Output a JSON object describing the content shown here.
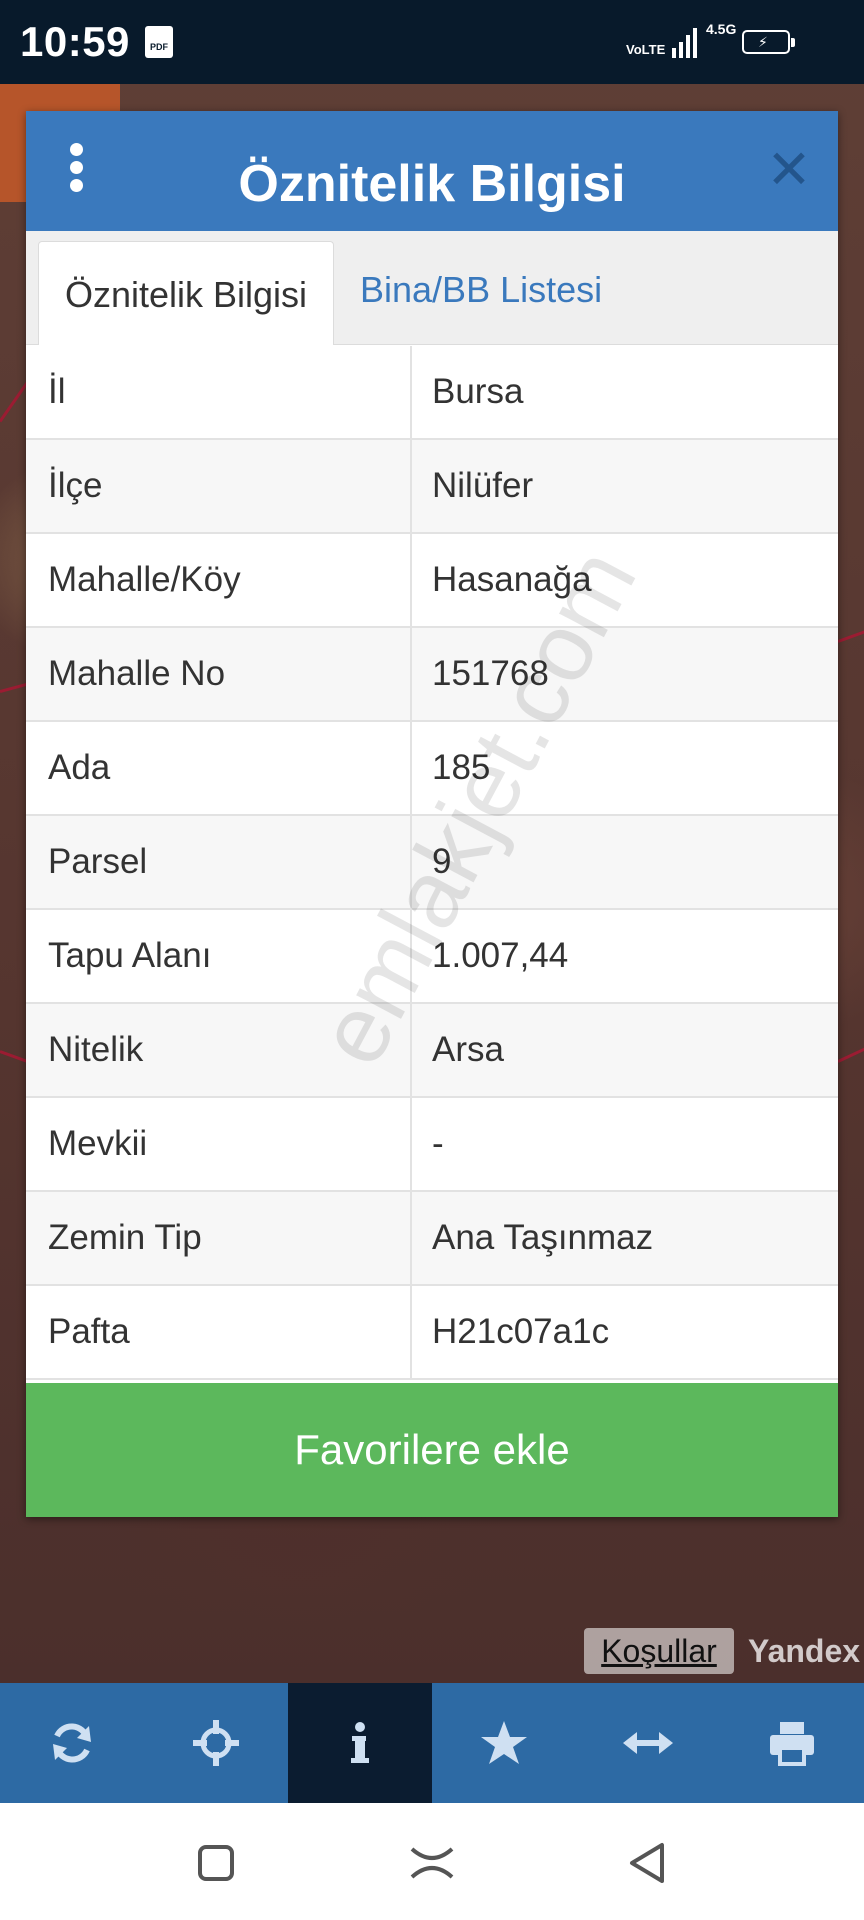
{
  "status_bar": {
    "time": "10:59",
    "notification_icon": "pdf-icon",
    "volte": "VoLTE",
    "network": "4.5G",
    "icons": [
      "signal-icon",
      "battery-charging-icon"
    ]
  },
  "dialog": {
    "title": "Öznitelik Bilgisi",
    "menu_icon": "more-vertical-icon",
    "close_icon": "close-icon",
    "tabs": [
      {
        "label": "Öznitelik Bilgisi",
        "active": true
      },
      {
        "label": "Bina/BB Listesi",
        "active": false
      }
    ],
    "rows": [
      {
        "key": "İl",
        "value": "Bursa"
      },
      {
        "key": "İlçe",
        "value": "Nilüfer"
      },
      {
        "key": "Mahalle/Köy",
        "value": "Hasanağa"
      },
      {
        "key": "Mahalle No",
        "value": "151768"
      },
      {
        "key": "Ada",
        "value": "185"
      },
      {
        "key": "Parsel",
        "value": "9"
      },
      {
        "key": "Tapu Alanı",
        "value": "1.007,44"
      },
      {
        "key": "Nitelik",
        "value": "Arsa"
      },
      {
        "key": "Mevkii",
        "value": "-"
      },
      {
        "key": "Zemin Tip",
        "value": "Ana Taşınmaz"
      },
      {
        "key": "Pafta",
        "value": "H21c07a1c"
      }
    ],
    "favorite_button": "Favorilere ekle",
    "watermark": "emlakjet.com"
  },
  "map": {
    "terms_link": "Koşullar",
    "provider": "Yandex"
  },
  "toolbar": {
    "items": [
      {
        "icon": "refresh-icon",
        "active": false
      },
      {
        "icon": "crosshair-icon",
        "active": false
      },
      {
        "icon": "info-icon",
        "active": true
      },
      {
        "icon": "star-icon",
        "active": false
      },
      {
        "icon": "measure-icon",
        "active": false
      },
      {
        "icon": "print-icon",
        "active": false
      }
    ]
  },
  "colors": {
    "header_blue": "#3a79bd",
    "toolbar_blue": "#2d6aa4",
    "active_tool": "#0b1c30",
    "favorite_green": "#5cb85c",
    "status_bar": "#081a2b"
  }
}
